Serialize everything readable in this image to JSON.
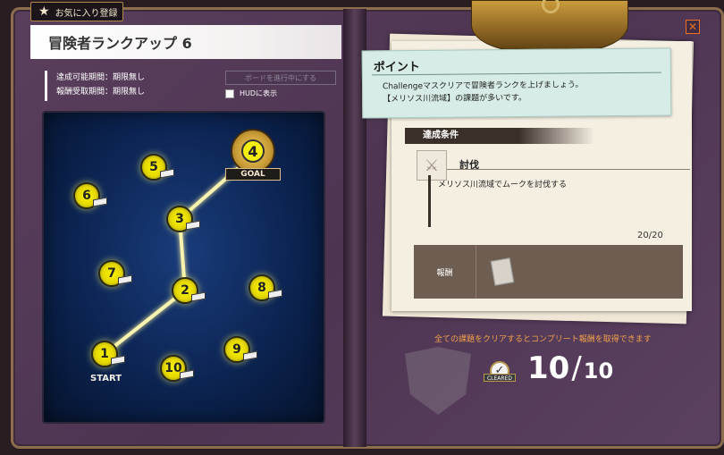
{
  "favorite_button": {
    "label": "お気に入り登録"
  },
  "page_title": "冒険者ランクアップ 6",
  "info": {
    "achievable_period": "達成可能期間：期限無し",
    "reward_period": "報酬受取期間：期限無し"
  },
  "board_button": {
    "label": "ボードを進行中にする"
  },
  "hud": {
    "label": "HUDに表示",
    "checked": false
  },
  "board": {
    "goal_label": "GOAL",
    "start_label": "START",
    "nodes": [
      "1",
      "2",
      "3",
      "4",
      "5",
      "6",
      "7",
      "8",
      "9",
      "10"
    ],
    "completed_path": [
      "1",
      "2",
      "3",
      "4"
    ]
  },
  "close_icon": "close-icon",
  "point": {
    "title": "ポイント",
    "line1": "Challengeマスクリアで冒険者ランクを上げましょう。",
    "line2": "【メリソス川流域】の課題が多いです。"
  },
  "condition": {
    "header": "達成条件",
    "task_title": "討伐",
    "task_desc": "メリソス川流域でムークを討伐する",
    "progress": "20/20"
  },
  "reward": {
    "label": "報酬"
  },
  "complete_note": "全ての課題をクリアするとコンプリート報酬を取得できます",
  "cleared_tag": "CLEARED",
  "count": {
    "cleared": "10",
    "separator": "/",
    "total": "10"
  },
  "colors": {
    "node_yellow": "#f7f400",
    "path_glow": "#f8f3b0",
    "accent_orange": "#f0a04a",
    "board_blue": "#0c2452"
  }
}
